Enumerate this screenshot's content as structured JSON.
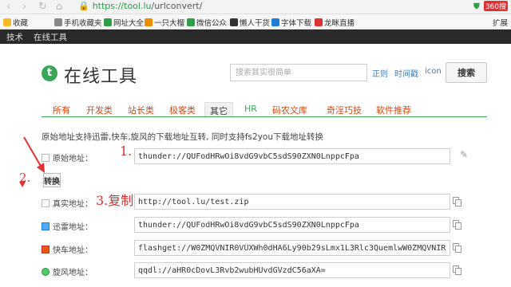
{
  "browser": {
    "nav": {
      "back": "‹",
      "forward": "›",
      "refresh": "↻",
      "home": "⌂"
    },
    "url_host": "https://tool.lu",
    "url_path": "/urlconvert/",
    "right_text": "360搜",
    "bookmarks": [
      {
        "label": "收藏",
        "color": "#f7b924"
      },
      {
        "label": "手机收藏夹",
        "color": "#888888"
      },
      {
        "label": "网址大全",
        "color": "#2f9e44"
      },
      {
        "label": "一只大榴",
        "color": "#f08c00"
      },
      {
        "label": "微信公众",
        "color": "#2f9e44"
      },
      {
        "label": "懒人干货",
        "color": "#333333"
      },
      {
        "label": "字体下载",
        "color": "#1c7ed6"
      },
      {
        "label": "龙眯直播",
        "color": "#e03131"
      }
    ],
    "bookmarks_right": "扩展"
  },
  "site_nav": [
    "技术",
    "在线工具"
  ],
  "header": {
    "logo_letter": "t",
    "title": "在线工具",
    "search_placeholder": "搜索其实很简单",
    "search_opts": [
      "正则",
      "时间戳",
      "icon"
    ],
    "search_button": "搜索"
  },
  "tabs": [
    "所有",
    "开发类",
    "站长类",
    "极客类",
    "其它",
    "HR",
    "码农文库",
    "奇淫巧技",
    "软件推荐"
  ],
  "active_tab": "其它",
  "description": "原始地址支持迅雷,快车,旋风的下载地址互转, 同时支持fs2you下载地址转换",
  "form": {
    "original_label": "原始地址：",
    "original_value": "thunder://QUFodHRwOi8vdG9vbC5sdS90ZXN0LnppcFpa",
    "convert_button": "转换",
    "rows": [
      {
        "label": "真实地址：",
        "value": "http://tool.lu/test.zip"
      },
      {
        "label": "迅雷地址：",
        "value": "thunder://QUFodHRwOi8vdG9vbC5sdS90ZXN0LnppcFpa"
      },
      {
        "label": "快车地址：",
        "value": "flashget://W0ZMQVNIR0VUXWh0dHA6Ly90b29sLmx1L3Rlc3QuemlwW0ZMQVNIR0VUXQ=="
      },
      {
        "label": "旋风地址：",
        "value": "qqdl://aHR0cDovL3Rvb2wubHUvdGVzdC56aXA="
      }
    ]
  },
  "annotations": {
    "step1": "1.",
    "step2": "2.",
    "step3": "3.复制"
  },
  "colors": {
    "brand_green": "#3aa757",
    "annotation_red": "#e03131",
    "tab_orange": "#d9480f"
  }
}
